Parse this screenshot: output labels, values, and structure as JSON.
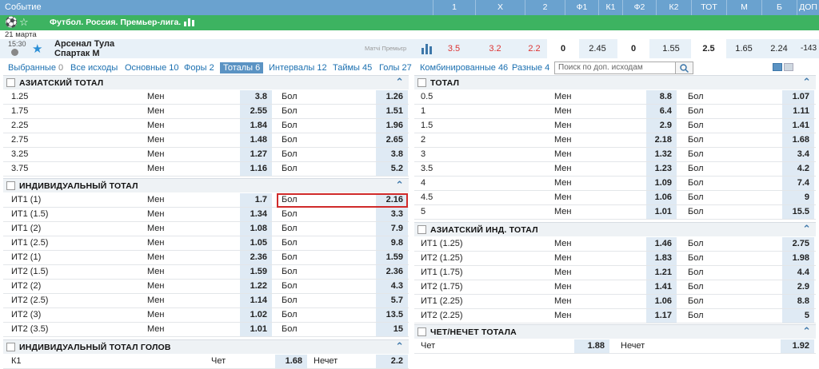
{
  "header": {
    "event": "Событие",
    "cols": [
      "1",
      "X",
      "2",
      "Ф1",
      "К1",
      "Ф2",
      "К2",
      "ТОТ",
      "М",
      "Б",
      "ДОП"
    ]
  },
  "league": {
    "name": "Футбол. Россия. Премьер-лига."
  },
  "match": {
    "date": "21 марта",
    "time": "15:30",
    "team1": "Арсенал Тула",
    "team2": "Спартак М",
    "note": "Матчі Премьєр",
    "odds": [
      "3.5",
      "3.2",
      "2.2",
      "0",
      "2.45",
      "0",
      "1.55",
      "2.5",
      "1.65",
      "2.24",
      "-143"
    ]
  },
  "tabs": [
    {
      "label": "Выбранные",
      "count": "0"
    },
    {
      "label": "Все исходы",
      "count": ""
    },
    {
      "label": "Основные",
      "count": "10"
    },
    {
      "label": "Форы",
      "count": "2"
    },
    {
      "label": "Тоталы",
      "count": "6"
    },
    {
      "label": "Интервалы",
      "count": "12"
    },
    {
      "label": "Таймы",
      "count": "45"
    },
    {
      "label": "Голы",
      "count": "27"
    },
    {
      "label": "Комбинированные",
      "count": "46"
    },
    {
      "label": "Разные",
      "count": "4"
    }
  ],
  "search": {
    "placeholder": "Поиск по доп. исходам"
  },
  "left": {
    "asian_total": {
      "title": "АЗИАТСКИЙ ТОТАЛ",
      "rows": [
        [
          "1.25",
          "Мен",
          "3.8",
          "Бол",
          "1.26"
        ],
        [
          "1.75",
          "Мен",
          "2.55",
          "Бол",
          "1.51"
        ],
        [
          "2.25",
          "Мен",
          "1.84",
          "Бол",
          "1.96"
        ],
        [
          "2.75",
          "Мен",
          "1.48",
          "Бол",
          "2.65"
        ],
        [
          "3.25",
          "Мен",
          "1.27",
          "Бол",
          "3.8"
        ],
        [
          "3.75",
          "Мен",
          "1.16",
          "Бол",
          "5.2"
        ]
      ]
    },
    "ind_total": {
      "title": "ИНДИВИДУАЛЬНЫЙ ТОТАЛ",
      "rows": [
        [
          "ИТ1 (1)",
          "Мен",
          "1.7",
          "Бол",
          "2.16"
        ],
        [
          "ИТ1 (1.5)",
          "Мен",
          "1.34",
          "Бол",
          "3.3"
        ],
        [
          "ИТ1 (2)",
          "Мен",
          "1.08",
          "Бол",
          "7.9"
        ],
        [
          "ИТ1 (2.5)",
          "Мен",
          "1.05",
          "Бол",
          "9.8"
        ],
        [
          "ИТ2 (1)",
          "Мен",
          "2.36",
          "Бол",
          "1.59"
        ],
        [
          "ИТ2 (1.5)",
          "Мен",
          "1.59",
          "Бол",
          "2.36"
        ],
        [
          "ИТ2 (2)",
          "Мен",
          "1.22",
          "Бол",
          "4.3"
        ],
        [
          "ИТ2 (2.5)",
          "Мен",
          "1.14",
          "Бол",
          "5.7"
        ],
        [
          "ИТ2 (3)",
          "Мен",
          "1.02",
          "Бол",
          "13.5"
        ],
        [
          "ИТ2 (3.5)",
          "Мен",
          "1.01",
          "Бол",
          "15"
        ]
      ]
    },
    "ind_goals": {
      "title": "ИНДИВИДУАЛЬНЫЙ ТОТАЛ ГОЛОВ",
      "rows": [
        [
          "К1",
          "Чет",
          "1.68",
          "Нечет",
          "2.2"
        ]
      ]
    }
  },
  "right": {
    "total": {
      "title": "ТОТАЛ",
      "rows": [
        [
          "0.5",
          "Мен",
          "8.8",
          "Бол",
          "1.07"
        ],
        [
          "1",
          "Мен",
          "6.4",
          "Бол",
          "1.11"
        ],
        [
          "1.5",
          "Мен",
          "2.9",
          "Бол",
          "1.41"
        ],
        [
          "2",
          "Мен",
          "2.18",
          "Бол",
          "1.68"
        ],
        [
          "3",
          "Мен",
          "1.32",
          "Бол",
          "3.4"
        ],
        [
          "3.5",
          "Мен",
          "1.23",
          "Бол",
          "4.2"
        ],
        [
          "4",
          "Мен",
          "1.09",
          "Бол",
          "7.4"
        ],
        [
          "4.5",
          "Мен",
          "1.06",
          "Бол",
          "9"
        ],
        [
          "5",
          "Мен",
          "1.01",
          "Бол",
          "15.5"
        ]
      ]
    },
    "asian_ind": {
      "title": "АЗИАТСКИЙ ИНД. ТОТАЛ",
      "rows": [
        [
          "ИТ1 (1.25)",
          "Мен",
          "1.46",
          "Бол",
          "2.75"
        ],
        [
          "ИТ2 (1.25)",
          "Мен",
          "1.83",
          "Бол",
          "1.98"
        ],
        [
          "ИТ1 (1.75)",
          "Мен",
          "1.21",
          "Бол",
          "4.4"
        ],
        [
          "ИТ2 (1.75)",
          "Мен",
          "1.41",
          "Бол",
          "2.9"
        ],
        [
          "ИТ1 (2.25)",
          "Мен",
          "1.06",
          "Бол",
          "8.8"
        ],
        [
          "ИТ2 (2.25)",
          "Мен",
          "1.17",
          "Бол",
          "5"
        ]
      ]
    },
    "even_odd": {
      "title": "ЧЕТ/НЕЧЕТ ТОТАЛА",
      "rows": [
        [
          "Чет",
          "1.88",
          "Нечет",
          "1.92"
        ]
      ]
    }
  }
}
